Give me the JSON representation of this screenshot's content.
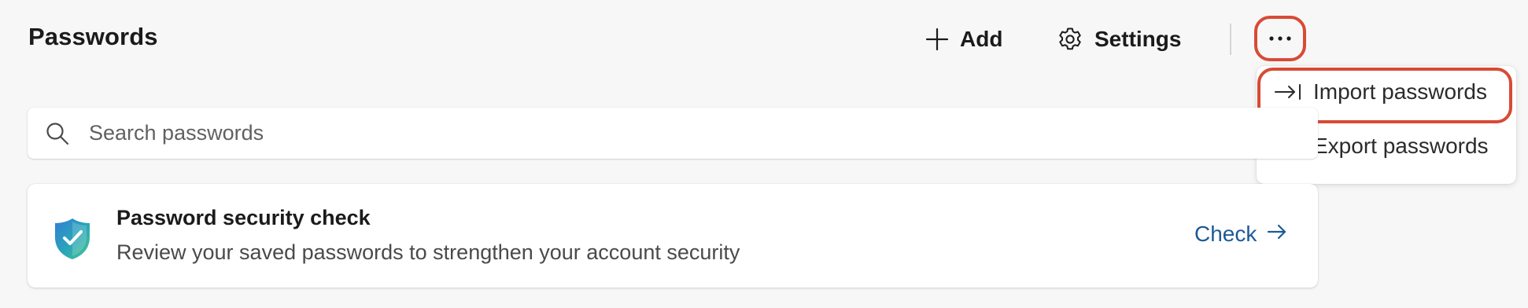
{
  "header": {
    "title": "Passwords",
    "add_label": "Add",
    "settings_label": "Settings",
    "more_icon": "more-horizontal-icon"
  },
  "menu": {
    "items": [
      {
        "label": "Import passwords",
        "icon": "import-arrow-icon"
      },
      {
        "label": "Export passwords",
        "icon": "export-arrow-icon"
      }
    ]
  },
  "search": {
    "placeholder": "Search passwords",
    "value": ""
  },
  "security_card": {
    "title": "Password security check",
    "description": "Review your saved passwords to strengthen your account security",
    "action_label": "Check",
    "icon": "shield-check-icon"
  },
  "colors": {
    "highlight": "#d84a35",
    "link": "#1d5a96",
    "background": "#f7f7f7"
  }
}
